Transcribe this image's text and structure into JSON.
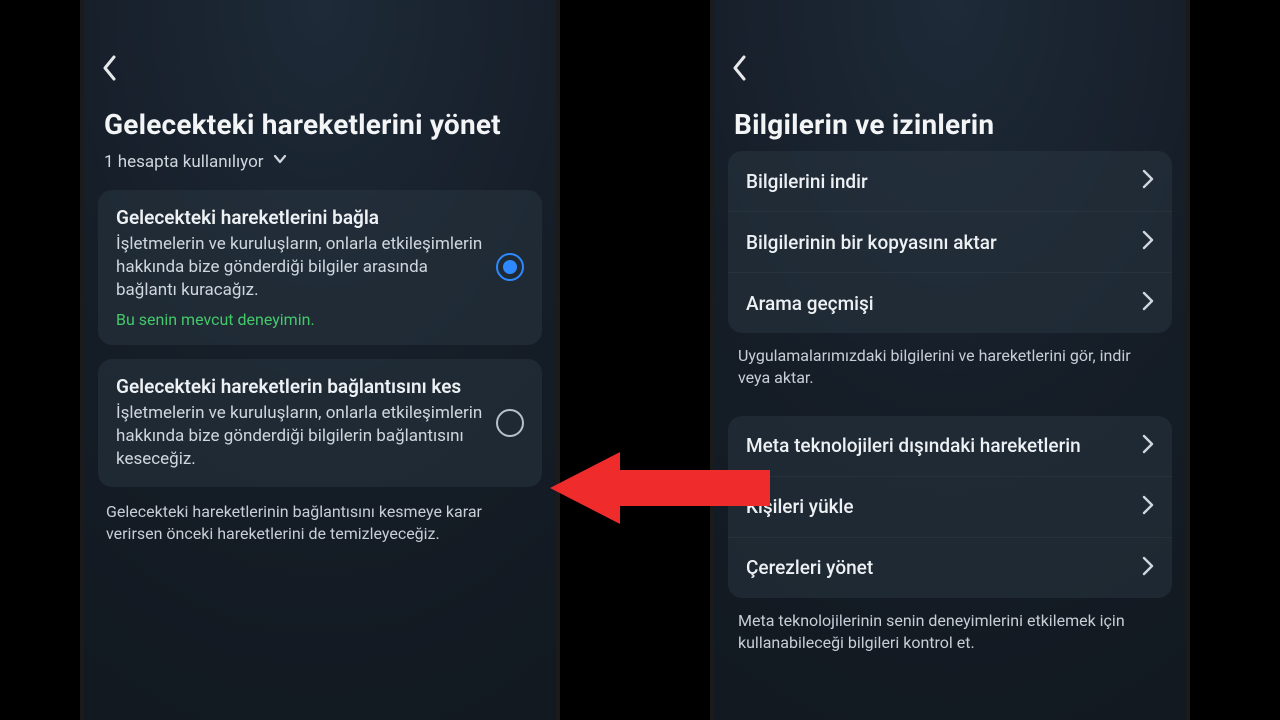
{
  "arrow": {
    "color": "#ef2b2b"
  },
  "left": {
    "title": "Gelecekteki hareketlerini yönet",
    "subtitle": "1 hesapta kullanılıyor",
    "option_connect": {
      "title": "Gelecekteki hareketlerini bağla",
      "body": "İşletmelerin ve kuruluşların, onlarla etkileşimlerin hakkında bize gönderdiği bilgiler arasında bağlantı kuracağız.",
      "note": "Bu senin mevcut deneyimin.",
      "selected": true
    },
    "option_disconnect": {
      "title": "Gelecekteki hareketlerin bağlantısını kes",
      "body": "İşletmelerin ve kuruluşların, onlarla etkileşimlerin hakkında bize gönderdiği bilgilerin bağlantısını keseceğiz.",
      "selected": false
    },
    "footnote": "Gelecekteki hareketlerinin bağlantısını kesmeye karar verirsen önceki hareketlerini de temizleyeceğiz."
  },
  "right": {
    "title": "Bilgilerin ve izinlerin",
    "group1": {
      "items": [
        {
          "label": "Bilgilerini indir"
        },
        {
          "label": "Bilgilerinin bir kopyasını aktar"
        },
        {
          "label": "Arama geçmişi"
        }
      ],
      "caption": "Uygulamalarımızdaki bilgilerini ve hareketlerini gör, indir veya aktar."
    },
    "group2": {
      "items": [
        {
          "label": "Meta teknolojileri dışındaki hareketlerin"
        },
        {
          "label": "Kişileri yükle"
        },
        {
          "label": "Çerezleri yönet"
        }
      ],
      "caption": "Meta teknolojilerinin senin deneyimlerini etkilemek için kullanabileceği bilgileri kontrol et."
    }
  }
}
